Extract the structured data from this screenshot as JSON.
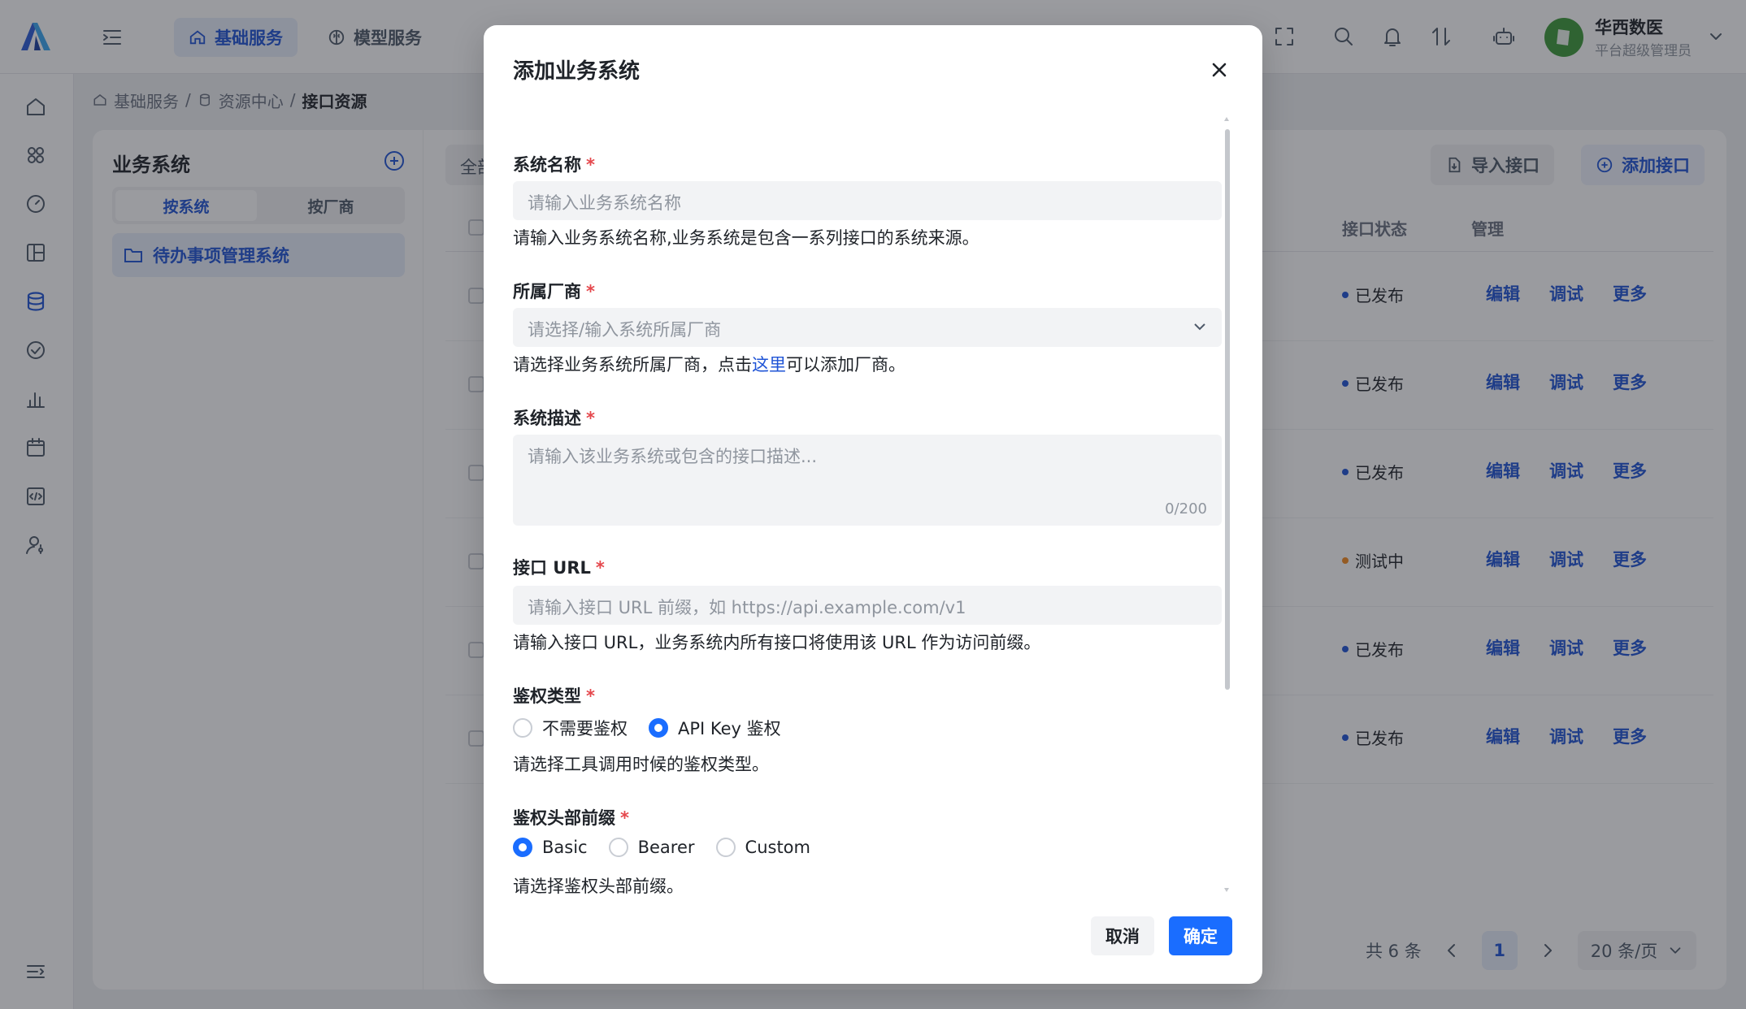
{
  "topbar": {
    "tabs": [
      {
        "label": "基础服务",
        "icon": "home-icon",
        "active": true
      },
      {
        "label": "模型服务",
        "icon": "brain-icon",
        "active": false
      }
    ],
    "user": {
      "name": "华西数医",
      "role": "平台超级管理员"
    }
  },
  "breadcrumb": {
    "items": [
      "基础服务",
      "资源中心",
      "接口资源"
    ],
    "separator": "/"
  },
  "sidebar": {
    "title": "业务系统",
    "segments": [
      "按系统",
      "按厂商"
    ],
    "active_segment": 0,
    "tree_item": "待办事项管理系统"
  },
  "toolbar": {
    "filter_label": "全部",
    "import_label": "导入接口",
    "add_label": "添加接口"
  },
  "table": {
    "columns": {
      "status": "接口状态",
      "manage": "管理"
    },
    "rows": [
      {
        "status": "已发布",
        "status_color": "#1f54d6"
      },
      {
        "status": "已发布",
        "status_color": "#1f54d6"
      },
      {
        "status": "已发布",
        "status_color": "#1f54d6"
      },
      {
        "status": "测试中",
        "status_color": "#f58a1f"
      },
      {
        "status": "已发布",
        "status_color": "#1f54d6"
      },
      {
        "status": "已发布",
        "status_color": "#1f54d6"
      }
    ],
    "actions": [
      "编辑",
      "调试",
      "更多"
    ]
  },
  "pagination": {
    "total_text": "共 6 条",
    "current_page": "1",
    "page_size": "20 条/页"
  },
  "modal": {
    "title": "添加业务系统",
    "fields": {
      "name": {
        "label": "系统名称",
        "placeholder": "请输入业务系统名称",
        "help": "请输入业务系统名称,业务系统是包含一系列接口的系统来源。"
      },
      "vendor": {
        "label": "所属厂商",
        "placeholder": "请选择/输入系统所属厂商",
        "help_prefix": "请选择业务系统所属厂商，点击",
        "help_link": "这里",
        "help_suffix": "可以添加厂商。"
      },
      "description": {
        "label": "系统描述",
        "placeholder": "请输入该业务系统或包含的接口描述...",
        "counter": "0/200"
      },
      "url": {
        "label": "接口 URL",
        "placeholder": "请输入接口 URL 前缀，如 https://api.example.com/v1",
        "help": "请输入接口 URL，业务系统内所有接口将使用该 URL 作为访问前缀。"
      },
      "auth_type": {
        "label": "鉴权类型",
        "options": [
          "不需要鉴权",
          "API Key 鉴权"
        ],
        "selected": 1,
        "help": "请选择工具调用时候的鉴权类型。"
      },
      "auth_prefix": {
        "label": "鉴权头部前缀",
        "options": [
          "Basic",
          "Bearer",
          "Custom"
        ],
        "selected": 0,
        "help": "请选择鉴权头部前缀。"
      }
    },
    "required_mark": "*",
    "cancel_label": "取消",
    "confirm_label": "确定"
  },
  "colors": {
    "primary": "#1a6dff",
    "brand_blue": "#1f54d6",
    "required": "#e5484d",
    "overlay": "rgba(30,34,42,0.45)"
  }
}
